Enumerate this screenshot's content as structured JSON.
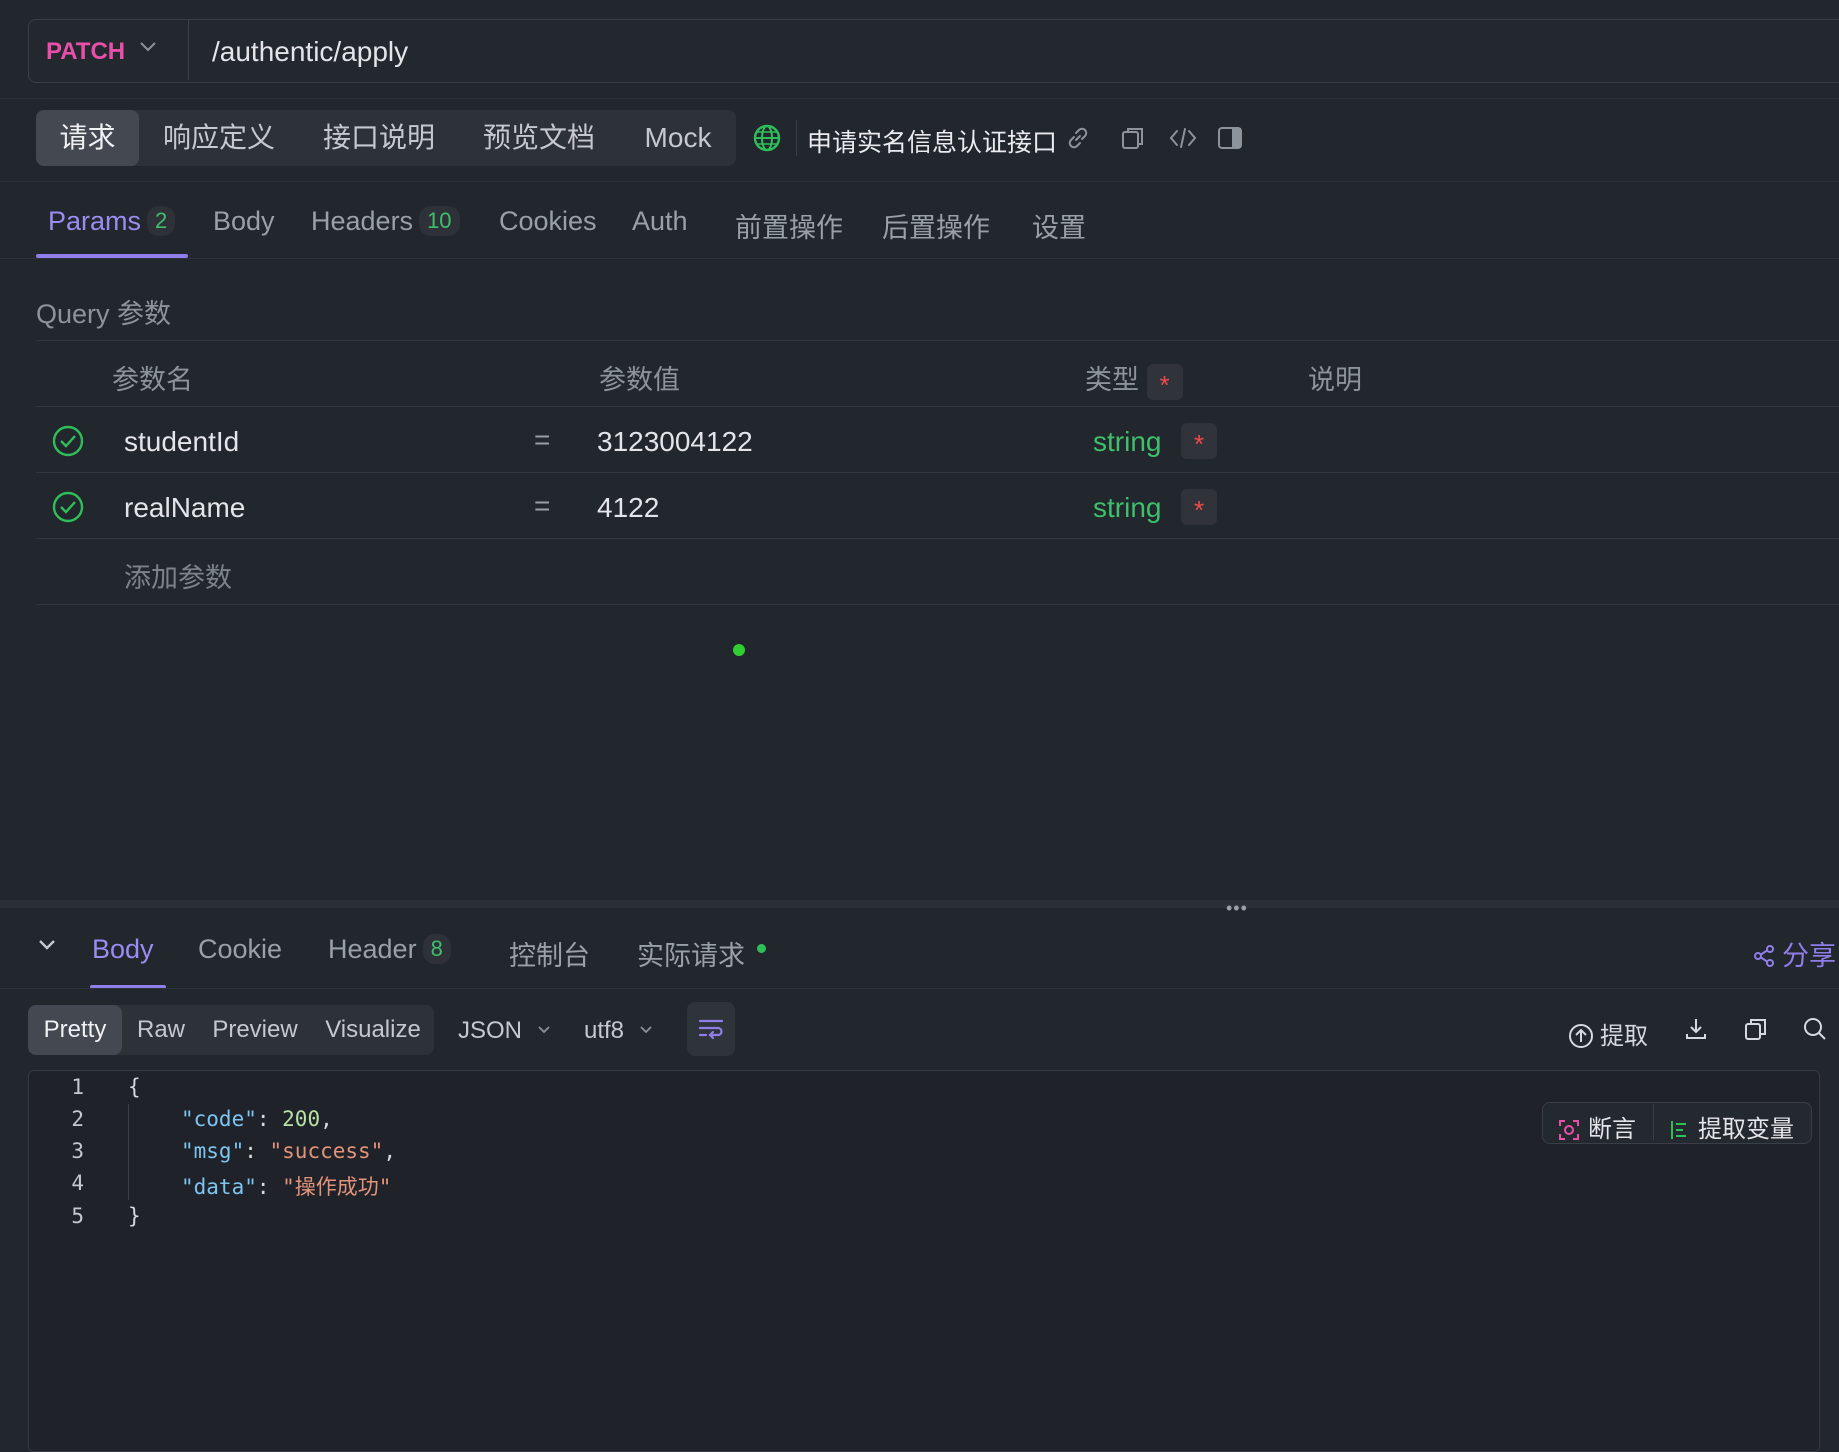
{
  "url_bar": {
    "method": "PATCH",
    "path": "/authentic/apply"
  },
  "top_tabs": [
    "请求",
    "响应定义",
    "接口说明",
    "预览文档",
    "Mock"
  ],
  "api_name": "申请实名信息认证接口",
  "param_tabs": {
    "params": "Params",
    "params_count": "2",
    "body": "Body",
    "headers": "Headers",
    "headers_count": "10",
    "cookies": "Cookies",
    "auth": "Auth",
    "pre": "前置操作",
    "post": "后置操作",
    "settings": "设置"
  },
  "query": {
    "section_label": "Query 参数",
    "headers": {
      "name": "参数名",
      "value": "参数值",
      "type": "类型",
      "required": "*",
      "desc": "说明"
    },
    "rows": [
      {
        "name": "studentId",
        "eq": "=",
        "value": "3123004122",
        "type": "string",
        "required": "*"
      },
      {
        "name": "realName",
        "eq": "=",
        "value": "4122",
        "type": "string",
        "required": "*"
      }
    ],
    "add_placeholder": "添加参数"
  },
  "splitter_dots": "•••",
  "response_tabs": {
    "body": "Body",
    "cookie": "Cookie",
    "header": "Header",
    "header_count": "8",
    "console": "控制台",
    "actual_request": "实际请求",
    "share": "分享"
  },
  "format_tabs": [
    "Pretty",
    "Raw",
    "Preview",
    "Visualize"
  ],
  "format_dropdown": "JSON",
  "encoding_dropdown": "utf8",
  "extract_label": "提取",
  "assert_label": "断言",
  "extract_var_label": "提取变量",
  "code": {
    "line_numbers": [
      "1",
      "2",
      "3",
      "4",
      "5"
    ],
    "open_brace": "{",
    "close_brace": "}",
    "code_key": "\"code\"",
    "code_val": "200",
    "msg_key": "\"msg\"",
    "msg_val": "\"success\"",
    "data_key": "\"data\"",
    "data_val": "\"操作成功\""
  },
  "colors": {
    "accent": "#8f7ee9",
    "method": "#e84fa8",
    "success": "#3fbf6a",
    "required": "#ef4a4a"
  }
}
